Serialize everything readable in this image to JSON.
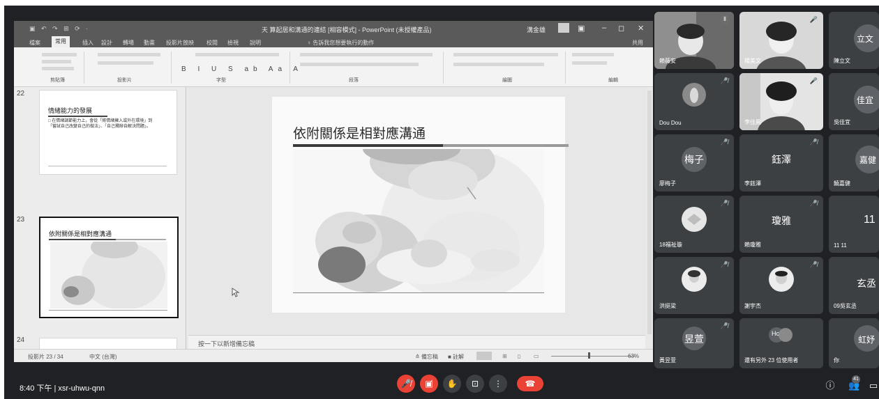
{
  "ppt": {
    "window_title": "天 算起居和溝通的連結 [相容模式] - PowerPoint (未授權產品)",
    "user_name": "溝金雄",
    "window_controls": {
      "ribbon": "▣",
      "minimize": "–",
      "maximize": "◻",
      "close": "✕"
    },
    "quick_access": "▣ ↶ ↷ ⊞ ⟳ ·",
    "menu_tabs": [
      "檔案",
      "常用",
      "插入",
      "設計",
      "轉場",
      "動畫",
      "投影片放映",
      "校閱",
      "檢視",
      "說明",
      "♀ 告訴我您想要執行的動作"
    ],
    "active_tab_index": 1,
    "share_label": "共用",
    "ribbon_groups": [
      "剪貼簿",
      "投影片",
      "字型",
      "段落",
      "繪圖",
      "編輯"
    ],
    "font_tools": "B I U S ab Aa A",
    "slides": [
      {
        "number": "22",
        "title": "情緒能力的發展",
        "body": "□ 在情緒調節能力上，會從「將情緒擁入或外在環境」到「嘗試自己改變自己的做法」、「自己獨辦自解決問題」。"
      },
      {
        "number": "23",
        "title": "依附關係是相對應溝通",
        "selected": true
      },
      {
        "number": "24"
      }
    ],
    "current_slide_title": "依附關係是相對應溝通",
    "notes_placeholder": "按一下以新增備忘稿",
    "status": {
      "slide_count": "投影片 23 / 34",
      "language": "中文 (台灣)",
      "notes_btn": "≙ 備忘稿",
      "comments_btn": "■ 註解",
      "zoom": "63%"
    }
  },
  "participants": [
    {
      "name": "賴薇安",
      "kind": "video",
      "talking": true
    },
    {
      "name": "楊美文",
      "kind": "video",
      "muted": true
    },
    {
      "name": "陳立文",
      "kind": "initials",
      "initials": "立文"
    },
    {
      "name": "Dou Dou",
      "kind": "avatar",
      "muted": true
    },
    {
      "name": "李佳鳳",
      "kind": "video",
      "muted": true
    },
    {
      "name": "吳佳宜",
      "kind": "initials",
      "initials": "佳宜"
    },
    {
      "name": "廖梅子",
      "kind": "initials",
      "initials": "梅子",
      "muted": true
    },
    {
      "name": "李鈺澤",
      "kind": "initials",
      "initials": "鈺澤",
      "muted": true
    },
    {
      "name": "饒嘉健",
      "kind": "initials",
      "initials": "嘉健"
    },
    {
      "name": "18福祉璇",
      "kind": "avatar",
      "muted": true
    },
    {
      "name": "賴瓊雅",
      "kind": "initials",
      "initials": "瓊雅",
      "muted": true
    },
    {
      "name": "11 11",
      "kind": "initials",
      "initials": "11"
    },
    {
      "name": "洪挺梁",
      "kind": "avatar",
      "muted": true
    },
    {
      "name": "謝宇杰",
      "kind": "avatar",
      "muted": true
    },
    {
      "name": "09吳玄丞",
      "kind": "initials",
      "initials": "玄丞"
    },
    {
      "name": "黃昱萱",
      "kind": "initials",
      "initials": "昱萱",
      "muted": true
    },
    {
      "name": "還有另外 23 位使用者",
      "kind": "others",
      "initials": "Hc"
    },
    {
      "name": "你",
      "kind": "initials",
      "initials": "虹妤"
    }
  ],
  "meeting": {
    "time_code": "8:40 下午 | xsr-uhwu-qnn",
    "participant_count": "41",
    "controls": {
      "mic": "🎤̸",
      "camera": "▣̸",
      "raise_hand": "✋",
      "present": "⊡",
      "more": "⋮",
      "leave": "☎"
    },
    "right_icons": {
      "info": "ⓘ",
      "people": "👥",
      "chat": "▭"
    }
  },
  "colors": {
    "meet_bg": "#202124",
    "tile_bg": "#3c4043",
    "leave_red": "#ea4335",
    "ppt_titlebar": "#5a5a5a"
  }
}
